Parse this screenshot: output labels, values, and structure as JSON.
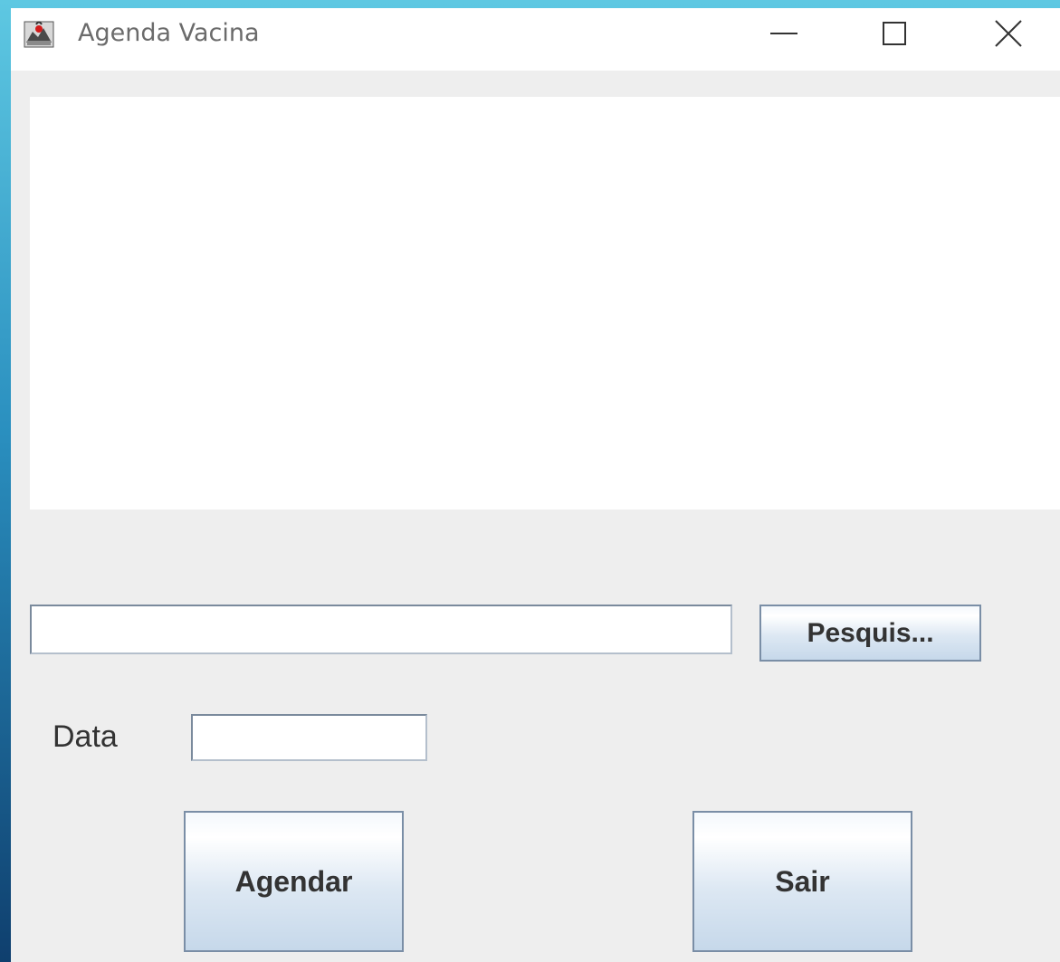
{
  "window": {
    "title": "Agenda Vacina",
    "icon": "java-app-icon",
    "controls": {
      "minimize_icon": "minimize-icon",
      "maximize_icon": "maximize-icon",
      "close_icon": "close-icon"
    }
  },
  "list": {
    "items": []
  },
  "search": {
    "value": "",
    "placeholder": "",
    "button_label": "Pesquis..."
  },
  "date_field": {
    "label": "Data",
    "value": ""
  },
  "actions": {
    "schedule_label": "Agendar",
    "exit_label": "Sair"
  },
  "colors": {
    "background": "#eeeeee",
    "titlebar": "#ffffff",
    "button_border": "#7a8ea6"
  }
}
